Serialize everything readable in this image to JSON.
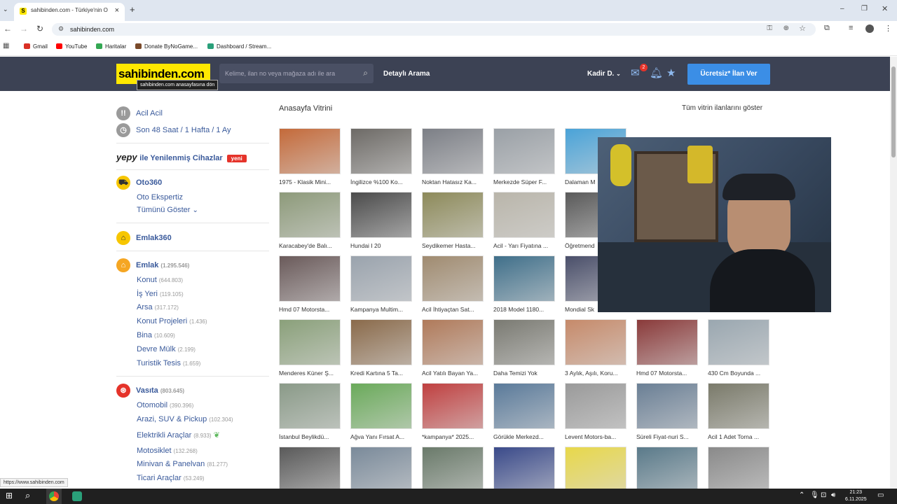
{
  "browser": {
    "tab_title": "sahibinden.com - Türkiye'nin O",
    "tab_favicon": "S",
    "url": "sahibinden.com",
    "bookmarks": [
      {
        "label": "Gmail",
        "color": "#d93025"
      },
      {
        "label": "YouTube",
        "color": "#ff0000"
      },
      {
        "label": "Haritalar",
        "color": "#34a853"
      },
      {
        "label": "Donate ByNoGame...",
        "color": "#7a4a2a"
      },
      {
        "label": "Dashboard / Stream...",
        "color": "#2aa07a"
      }
    ]
  },
  "header": {
    "logo": "sahibinden.com",
    "logo_tooltip": "sahibinden.com anasayfasına dön",
    "search_placeholder": "Kelime, ilan no veya mağaza adı ile ara",
    "detailed_search": "Detaylı Arama",
    "user": "Kadir D.",
    "mail_badge": "2",
    "cta": "Ücretsiz* İlan Ver"
  },
  "sidebar": {
    "quick": [
      {
        "label": "Acil Acil",
        "icon": "exclamation-icon"
      },
      {
        "label": "Son 48 Saat / 1 Hafta / 1 Ay",
        "icon": "clock-icon"
      }
    ],
    "yepy_logo": "yepy",
    "yepy_label": "ile Yenilenmiş Cihazlar",
    "yepy_badge": "yeni",
    "oto360": {
      "title": "Oto360",
      "items": [
        "Oto Ekspertiz"
      ],
      "more": "Tümünü Göster"
    },
    "emlak360": "Emlak360",
    "emlak": {
      "title": "Emlak",
      "count": "(1.295.546)",
      "items": [
        {
          "label": "Konut",
          "count": "(644.803)"
        },
        {
          "label": "İş Yeri",
          "count": "(119.105)"
        },
        {
          "label": "Arsa",
          "count": "(317.172)"
        },
        {
          "label": "Konut Projeleri",
          "count": "(1.436)"
        },
        {
          "label": "Bina",
          "count": "(10.609)"
        },
        {
          "label": "Devre Mülk",
          "count": "(2.199)"
        },
        {
          "label": "Turistik Tesis",
          "count": "(1.659)"
        }
      ]
    },
    "vasita": {
      "title": "Vasıta",
      "count": "(803.645)",
      "items": [
        {
          "label": "Otomobil",
          "count": "(390.396)"
        },
        {
          "label": "Arazi, SUV & Pickup",
          "count": "(102.304)"
        },
        {
          "label": "Elektrikli Araçlar",
          "count": "(8.933)"
        },
        {
          "label": "Motosiklet",
          "count": "(132.268)"
        },
        {
          "label": "Minivan & Panelvan",
          "count": "(81.277)"
        },
        {
          "label": "Ticari Araçlar",
          "count": "(53.249)"
        }
      ]
    }
  },
  "showcase": {
    "title": "Anasayfa Vitrini",
    "all_link": "Tüm vitrin ilanlarını göster",
    "rows": [
      [
        "1975 - Klasik Mini...",
        "İngilizce %100 Ko...",
        "Noktan Hatasız Ka...",
        "Merkezde Süper F...",
        "Dalaman M",
        "",
        ""
      ],
      [
        "Karacabey'de Balı...",
        "Hundai I 20",
        "Seydikemer Hasta...",
        "Acil - Yarı Fiyatına ...",
        "Öğretmend",
        "",
        ""
      ],
      [
        "Hmd 07 Motorsta...",
        "Kampanya Multim...",
        "Acil İhtiyaçtan Sat...",
        "2018 Model 1180...",
        "Mondial Sk",
        "",
        ""
      ],
      [
        "Menderes Küner Ş...",
        "Kredi Kartına 5 Ta...",
        "Acil Yatılı Bayan Ya...",
        "Daha Temizi Yok",
        "3 Aylık, Aşılı, Koru...",
        "Hmd 07 Motorsta...",
        "430 Cm Boyunda ..."
      ],
      [
        "İstanbul Beylikdü...",
        "Ağva Yanı Fırsat A...",
        "*kampanya* 2025...",
        "Görükle Merkezd...",
        "Levent Motors-ba...",
        "Süreli Fiyat-nuri S...",
        "Acil 1 Adet Torna ..."
      ],
      [
        "",
        "",
        "",
        "",
        "",
        "",
        ""
      ]
    ],
    "thumb_colors": [
      [
        "#c46a3a",
        "#6d6a66",
        "#7c7f86",
        "#9aa0a6",
        "#4aa3d8",
        "#5b6472",
        "#6a9fd0"
      ],
      [
        "#8d9a7a",
        "#4b4b4b",
        "#8d8a5a",
        "#b9b5aa",
        "#5a5a5a",
        "#7a7a7a",
        "#9a9a9a"
      ],
      [
        "#6a5a5a",
        "#9aa3ad",
        "#a08b70",
        "#3f6f8a",
        "#4a4f6a",
        "#777",
        "#888"
      ],
      [
        "#8aa07a",
        "#8a6a4a",
        "#b07a5a",
        "#7a7a72",
        "#c68a6a",
        "#8a3a3a",
        "#9aa7b0"
      ],
      [
        "#8a9a88",
        "#6aaa5a",
        "#c04040",
        "#5a7a9a",
        "#9a9a9a",
        "#6a7f95",
        "#7a7a6a"
      ],
      [
        "#5a5a5a",
        "#7a8a9a",
        "#6a7a6a",
        "#3a4a8a",
        "#e8d84a",
        "#5a7a8a",
        "#8a8a8a"
      ]
    ]
  },
  "status_url": "https://www.sahibinden.com",
  "clock": {
    "time": "21:23",
    "date": "6.11.2025"
  }
}
